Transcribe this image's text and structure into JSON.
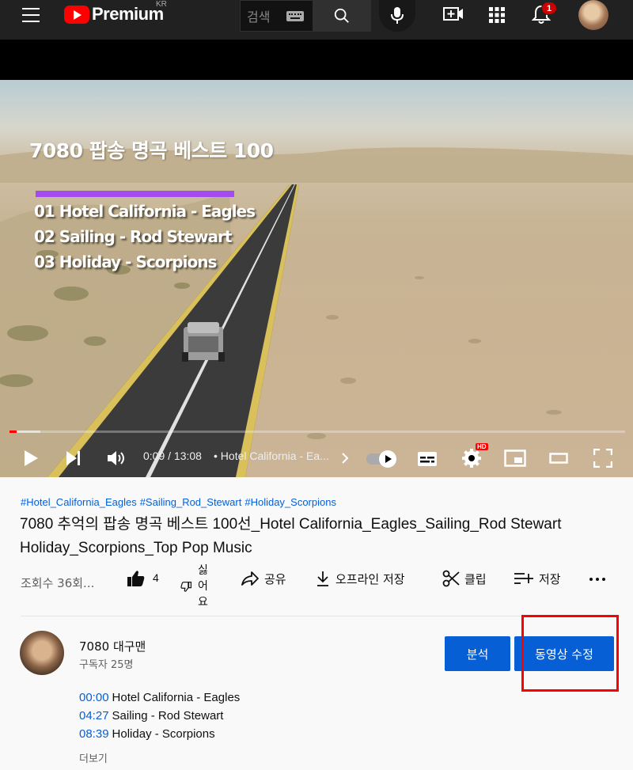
{
  "header": {
    "logo_text": "Premium",
    "logo_region": "KR",
    "search_placeholder": "검색",
    "notification_count": "1",
    "icons": [
      "menu-icon",
      "youtube-logo-icon",
      "keyboard-icon",
      "search-icon",
      "mic-icon",
      "create-icon",
      "apps-icon",
      "bell-icon",
      "avatar"
    ]
  },
  "video": {
    "overlay_title": "7080 팝송 명곡 베스트 100",
    "overlay_tracks": [
      "01  Hotel California - Eagles",
      "02  Sailing - Rod Stewart",
      "03  Holiday - Scorpions"
    ],
    "accent_bar_color": "#a24cf0",
    "progress_fraction": 0.0115,
    "buffer_fraction": 0.05
  },
  "player_controls": {
    "time": "0:09 / 13:08",
    "chapter": "• Hotel California - Ea...",
    "hd_badge": "HD",
    "icons": [
      "play-icon",
      "next-icon",
      "volume-icon",
      "chapter-chevron-icon",
      "autoplay-toggle",
      "subtitles-icon",
      "settings-icon",
      "miniplayer-icon",
      "theater-icon",
      "fullscreen-icon"
    ]
  },
  "meta": {
    "hashtags": [
      "#Hotel_California_Eagles",
      "#Sailing_Rod_Stewart",
      "#Holiday_Scorpions"
    ],
    "title": "7080 추억의 팝송 명곡 베스트 100선_Hotel California_Eagles_Sailing_Rod Stewart Holiday_Scorpions_Top Pop Music",
    "views": "조회수 36회...",
    "like_count": "4",
    "dislike_label": "싫어요",
    "actions": {
      "share": "공유",
      "offline_save": "오프라인 저장",
      "clip": "클립",
      "save": "저장"
    }
  },
  "channel": {
    "name": "7080 대구맨",
    "subscribers": "구독자 25명",
    "analytics_button": "분석",
    "edit_video_button": "동영상 수정"
  },
  "description": {
    "chapters": [
      {
        "time": "00:00",
        "title": "Hotel California - Eagles"
      },
      {
        "time": "04:27",
        "title": "Sailing - Rod Stewart"
      },
      {
        "time": "08:39",
        "title": "Holiday - Scorpions"
      }
    ],
    "more": "더보기"
  },
  "colors": {
    "brand_red": "#ff0000",
    "link_blue": "#065fd4",
    "button_blue": "#065fd4",
    "highlight_box": "#ff0000",
    "topbar_bg": "#212121"
  }
}
